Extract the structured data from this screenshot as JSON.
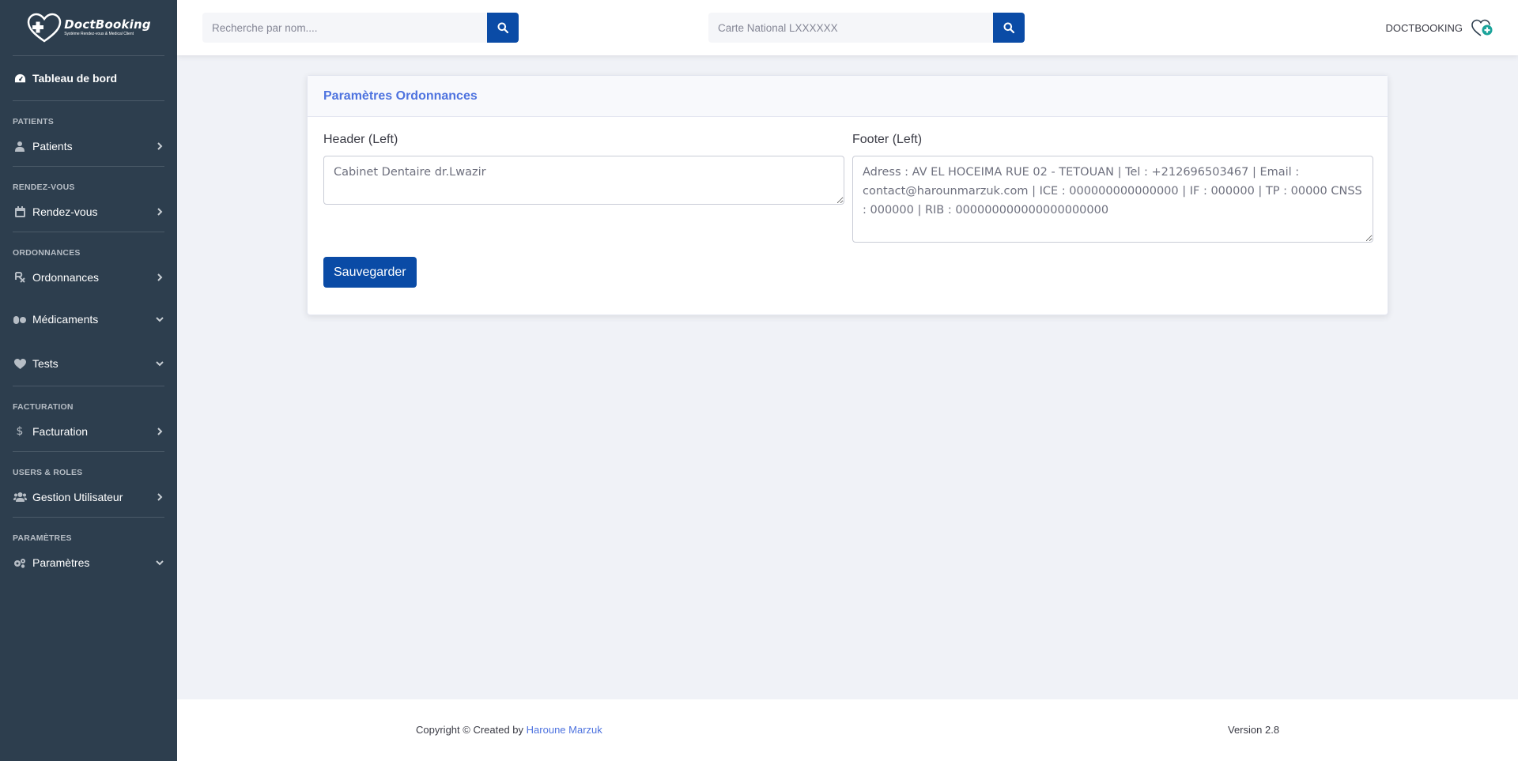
{
  "brand": {
    "name": "DoctBooking",
    "tagline": "Système Rendez-vous & Medical Client"
  },
  "sidebar": {
    "dashboard": "Tableau de bord",
    "sections": {
      "patients": "PATIENTS",
      "rdv": "RENDEZ-VOUS",
      "ordonnances": "ORDONNANCES",
      "facturation": "FACTURATION",
      "users": "USERS & ROLES",
      "parametres": "PARAMÈTRES"
    },
    "items": {
      "patients": "Patients",
      "rdv": "Rendez-vous",
      "ordonnances": "Ordonnances",
      "medicaments": "Médicaments",
      "tests": "Tests",
      "facturation": "Facturation",
      "users": "Gestion Utilisateur",
      "parametres": "Paramètres"
    }
  },
  "topbar": {
    "search_name_placeholder": "Recherche par nom....",
    "search_cin_placeholder": "Carte National LXXXXXX",
    "user_name": "DOCTBOOKING"
  },
  "card": {
    "title": "Paramètres Ordonnances",
    "header_label": "Header (Left)",
    "header_value": "Cabinet Dentaire dr.Lwazir",
    "footer_label": "Footer (Left)",
    "footer_value": "Adress : AV EL HOCEIMA RUE 02 - TETOUAN | Tel : +212696503467 | Email : contact@harounmarzuk.com | ICE : 000000000000000 | IF : 000000 | TP : 00000 CNSS : 000000 | RIB : 000000000000000000000",
    "save_label": "Sauvegarder"
  },
  "footer": {
    "copyright": "Copyright © Created by ",
    "author": "Haroune Marzuk",
    "version": "Version 2.8"
  },
  "colors": {
    "sidebar": "#2d3e4e",
    "primary": "#0a4ba6",
    "accent": "#4e73df",
    "background": "#f0f2f7"
  }
}
